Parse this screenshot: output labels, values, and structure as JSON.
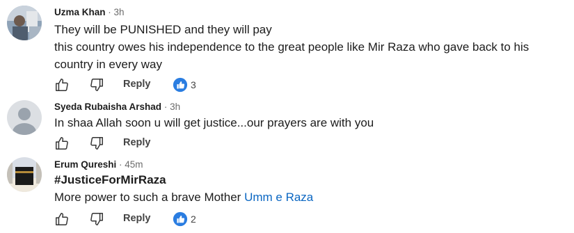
{
  "colors": {
    "link": "#0a66c2",
    "like_badge": "#2a7de1"
  },
  "comments": [
    {
      "author": "Uzma Khan",
      "time": "· 3h",
      "lines": [
        "They will be PUNISHED and they will pay",
        "this country owes his independence to the great people like Mir Raza who gave back to his country in every way"
      ],
      "reply_label": "Reply",
      "like_count": "3",
      "avatar_icon": "photo-avatar"
    },
    {
      "author": "Syeda Rubaisha Arshad",
      "time": "· 3h",
      "lines": [
        "In shaa Allah soon u will get justice...our prayers are with you"
      ],
      "reply_label": "Reply",
      "like_count": "",
      "avatar_icon": "default-person-avatar"
    },
    {
      "author": "Erum Qureshi",
      "time": "· 45m",
      "hashtag": "#JusticeForMirRaza",
      "text_before_mention": "More power to such a brave Mother ",
      "mention": "Umm e Raza",
      "reply_label": "Reply",
      "like_count": "2",
      "avatar_icon": "kaaba-photo-avatar"
    }
  ]
}
